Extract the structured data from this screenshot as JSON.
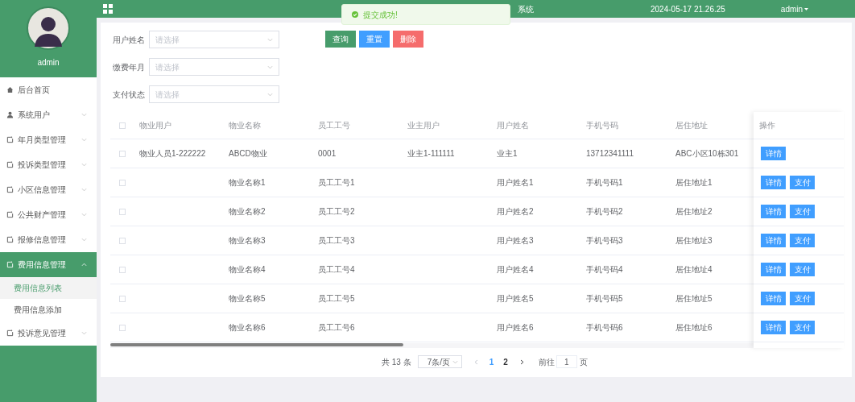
{
  "sidebar": {
    "user": "admin",
    "items": [
      {
        "label": "后台首页",
        "kind": "home",
        "selected": false
      },
      {
        "label": "系统用户",
        "kind": "user",
        "expanded": false,
        "selected": false
      },
      {
        "label": "年月类型管理",
        "kind": "folder",
        "expanded": false,
        "selected": false
      },
      {
        "label": "投诉类型管理",
        "kind": "folder",
        "expanded": false,
        "selected": false
      },
      {
        "label": "小区信息管理",
        "kind": "folder",
        "expanded": false,
        "selected": false
      },
      {
        "label": "公共财产管理",
        "kind": "folder",
        "expanded": false,
        "selected": false
      },
      {
        "label": "报修信息管理",
        "kind": "folder",
        "expanded": false,
        "selected": false
      },
      {
        "label": "费用信息管理",
        "kind": "folder",
        "expanded": true,
        "selected": true,
        "children": [
          {
            "label": "费用信息列表",
            "selected": true
          },
          {
            "label": "费用信息添加",
            "selected": false
          }
        ]
      },
      {
        "label": "投诉意见管理",
        "kind": "folder",
        "expanded": false,
        "selected": false
      }
    ]
  },
  "header": {
    "title": "系统",
    "datetime": "2024-05-17 21.26.25",
    "user": "admin"
  },
  "toast": {
    "message": "提交成功!"
  },
  "filters": [
    {
      "label": "用户姓名",
      "placeholder": "请选择"
    },
    {
      "label": "缴费年月",
      "placeholder": "请选择"
    },
    {
      "label": "支付状态",
      "placeholder": "请选择"
    }
  ],
  "buttons": [
    {
      "label": "查询",
      "kind": "primary"
    },
    {
      "label": "重置",
      "kind": "info"
    },
    {
      "label": "删除",
      "kind": "danger"
    }
  ],
  "table": {
    "checked": false,
    "columns": [
      "物业用户",
      "物业名称",
      "员工工号",
      "业主用户",
      "用户姓名",
      "手机号码",
      "居住地址"
    ],
    "action_column": "操作",
    "rows": [
      {
        "checked": false,
        "cells": [
          "物业人员1-222222",
          "ABCD物业",
          "0001",
          "业主1-111111",
          "业主1",
          "13712341111",
          "ABC小区10栋301"
        ],
        "actions": [
          "详情"
        ]
      },
      {
        "checked": false,
        "cells": [
          "",
          "物业名称1",
          "员工工号1",
          "",
          "用户姓名1",
          "手机号码1",
          "居住地址1"
        ],
        "actions": [
          "详情",
          "支付"
        ]
      },
      {
        "checked": false,
        "cells": [
          "",
          "物业名称2",
          "员工工号2",
          "",
          "用户姓名2",
          "手机号码2",
          "居住地址2"
        ],
        "actions": [
          "详情",
          "支付"
        ]
      },
      {
        "checked": false,
        "cells": [
          "",
          "物业名称3",
          "员工工号3",
          "",
          "用户姓名3",
          "手机号码3",
          "居住地址3"
        ],
        "actions": [
          "详情",
          "支付"
        ]
      },
      {
        "checked": false,
        "cells": [
          "",
          "物业名称4",
          "员工工号4",
          "",
          "用户姓名4",
          "手机号码4",
          "居住地址4"
        ],
        "actions": [
          "详情",
          "支付"
        ]
      },
      {
        "checked": false,
        "cells": [
          "",
          "物业名称5",
          "员工工号5",
          "",
          "用户姓名5",
          "手机号码5",
          "居住地址5"
        ],
        "actions": [
          "详情",
          "支付"
        ]
      },
      {
        "checked": false,
        "cells": [
          "",
          "物业名称6",
          "员工工号6",
          "",
          "用户姓名6",
          "手机号码6",
          "居住地址6"
        ],
        "actions": [
          "详情",
          "支付"
        ]
      }
    ]
  },
  "pagination": {
    "total": "共 13 条",
    "page_size": "7条/页",
    "pages": [
      {
        "label": "1",
        "selected": true
      },
      {
        "label": "2",
        "selected": false
      }
    ],
    "goto_label": "前往",
    "goto_value": "1",
    "goto_suffix": "页"
  }
}
